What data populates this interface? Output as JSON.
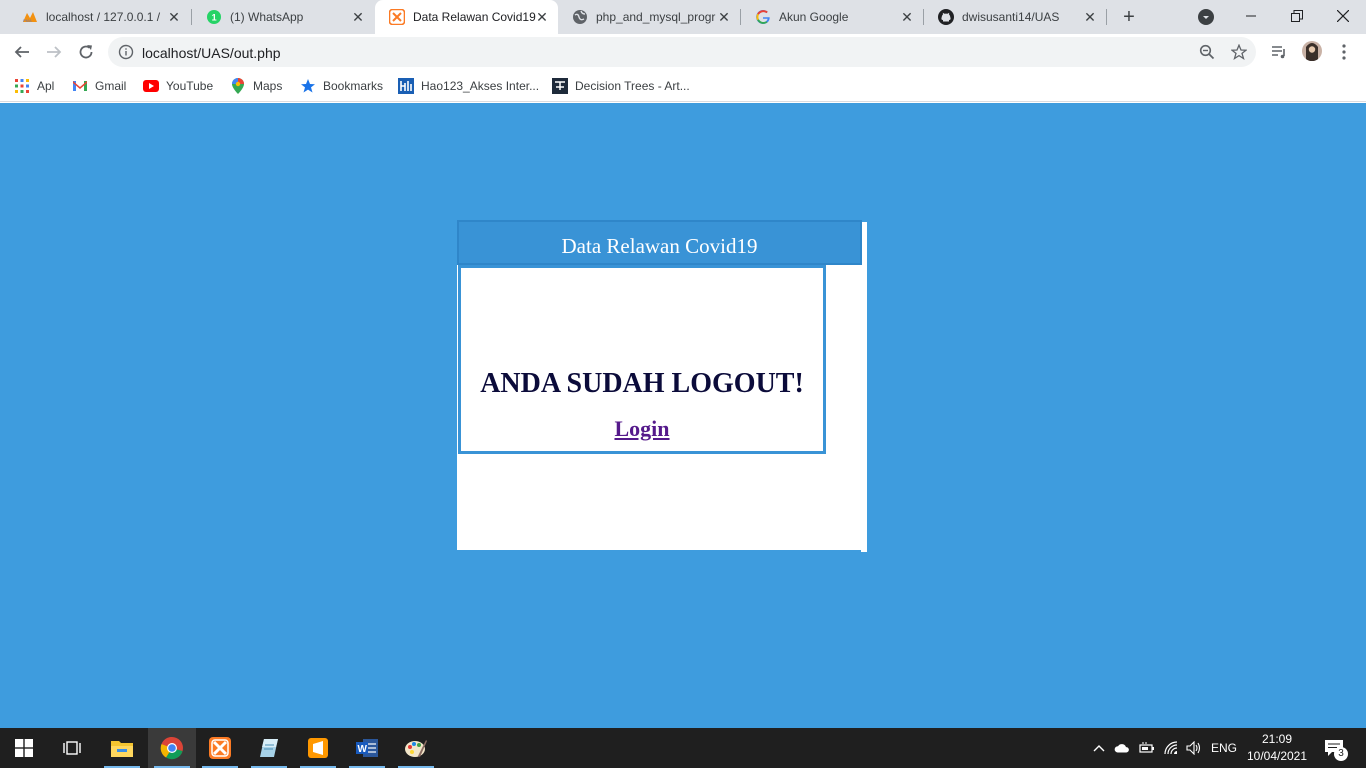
{
  "browser": {
    "tabs": [
      {
        "title": "localhost / 127.0.0.1 / ",
        "icon": "phpmyadmin-icon"
      },
      {
        "title": "(1) WhatsApp",
        "icon": "whatsapp-icon"
      },
      {
        "title": "Data Relawan Covid19",
        "icon": "xampp-icon",
        "active": true
      },
      {
        "title": "php_and_mysql_progr",
        "icon": "globe-icon"
      },
      {
        "title": "Akun Google",
        "icon": "google-icon"
      },
      {
        "title": "dwisusanti14/UAS",
        "icon": "github-icon"
      }
    ],
    "address_bar": {
      "url": "localhost/UAS/out.php"
    },
    "bookmarks": [
      {
        "label": "Apl",
        "icon": "apps-grid-icon"
      },
      {
        "label": "Gmail",
        "icon": "gmail-icon"
      },
      {
        "label": "YouTube",
        "icon": "youtube-icon"
      },
      {
        "label": "Maps",
        "icon": "maps-icon"
      },
      {
        "label": "Bookmarks",
        "icon": "star-icon"
      },
      {
        "label": "Hao123_Akses Inter...",
        "icon": "hao123-icon"
      },
      {
        "label": "Decision Trees - Art...",
        "icon": "decision-trees-icon"
      }
    ]
  },
  "page": {
    "header_title": "Data Relawan Covid19",
    "message": "ANDA SUDAH LOGOUT!",
    "login_link": "Login",
    "background_color": "#3e9cde",
    "header_color": "#3993d6"
  },
  "taskbar": {
    "apps": [
      "start-icon",
      "task-view-icon",
      "file-explorer-icon",
      "chrome-icon",
      "xampp-icon",
      "notepad-icon",
      "sublime-text-icon",
      "word-icon",
      "paint-icon"
    ],
    "language": "ENG",
    "time": "21:09",
    "date": "10/04/2021",
    "notification_count": "3"
  }
}
